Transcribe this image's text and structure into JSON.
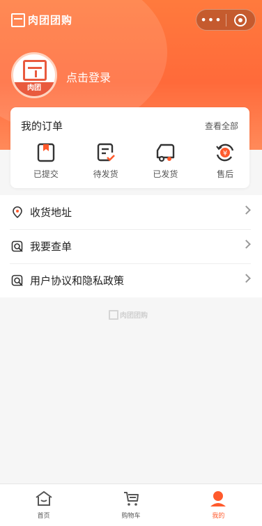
{
  "brand": {
    "text": "肉团团购"
  },
  "capsule": {
    "more": "•••"
  },
  "profile": {
    "login_label": "点击登录",
    "avatar_text": "肉团"
  },
  "orders": {
    "title": "我的订单",
    "view_all": "查看全部",
    "items": [
      {
        "label": "已提交",
        "icon": "submitted-icon"
      },
      {
        "label": "待发货",
        "icon": "pending-shipment-icon"
      },
      {
        "label": "已发货",
        "icon": "truck-icon"
      },
      {
        "label": "售后",
        "icon": "after-sales-icon"
      }
    ]
  },
  "menu": {
    "items": [
      {
        "label": "收货地址",
        "icon": "location-pin-icon"
      },
      {
        "label": "我要查单",
        "icon": "search-order-icon"
      },
      {
        "label": "用户协议和隐私政策",
        "icon": "agreement-icon"
      }
    ]
  },
  "footer": {
    "logo_text": "肉团团购"
  },
  "tabbar": {
    "items": [
      {
        "label": "首页",
        "icon": "home-icon"
      },
      {
        "label": "购物车",
        "icon": "cart-icon"
      },
      {
        "label": "我的",
        "icon": "user-icon",
        "active": true
      }
    ]
  },
  "colors": {
    "accent": "#ff5a2c",
    "hero": "#ff6a3a"
  }
}
